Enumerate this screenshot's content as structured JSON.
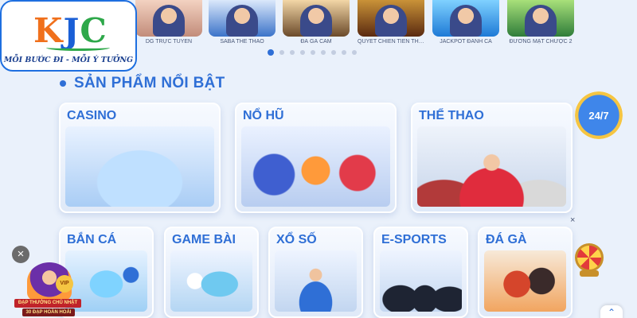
{
  "logo": {
    "brand_k": "K",
    "brand_j": "J",
    "brand_c": "C",
    "slogan": "MỖI BƯỚC ĐI - MỖI Ý TƯỞNG"
  },
  "game_strip": [
    {
      "caption": "DG TRỰC TUYẾN"
    },
    {
      "caption": "SABA THỂ THAO"
    },
    {
      "caption": "ĐÁ GÀ CAM"
    },
    {
      "caption": "QUYẾT CHIẾN TIỀN THU..."
    },
    {
      "caption": "JACKPOT ĐÁNH CÁ"
    },
    {
      "caption": "ĐƯỜNG MẠT CHƯỢC 2"
    }
  ],
  "carousel": {
    "total_dots": 9,
    "active_index": 0
  },
  "section": {
    "title": "SẢN PHẨM NỔI BẬT"
  },
  "products_top": [
    {
      "label": "CASINO"
    },
    {
      "label": "NỔ HŨ"
    },
    {
      "label": "THỂ THAO"
    }
  ],
  "products_bottom": [
    {
      "label": "BẮN CÁ"
    },
    {
      "label": "GAME BÀI"
    },
    {
      "label": "XỔ SỐ"
    },
    {
      "label": "E-SPORTS"
    },
    {
      "label": "ĐÁ GÀ"
    }
  ],
  "support_badge": {
    "text": "24/7"
  },
  "promo": {
    "close_symbol": "×",
    "vip": "VIP",
    "banner_line1": "ĐẠP THƯỞNG CHỦ NHẬT",
    "banner_line2": "30 ĐẠP HOÀN HOẢI"
  },
  "float_close_symbol": "×",
  "scroll_top_symbol": "⌃"
}
